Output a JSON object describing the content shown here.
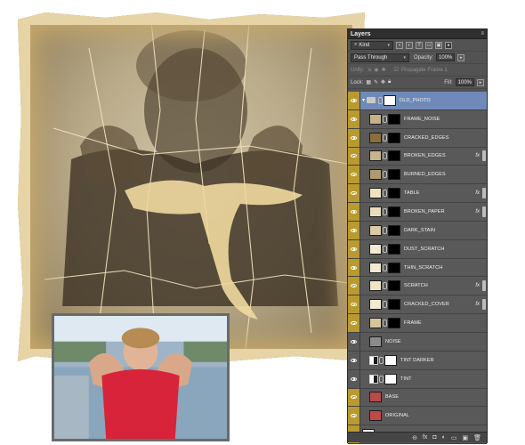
{
  "panel": {
    "title": "Layers",
    "menu_icon": "≡",
    "kind_label": "Kind",
    "blend_mode": "Pass Through",
    "opacity_label": "Opacity:",
    "opacity_value": "100%",
    "unify_label": "Unify:",
    "propagate_label": "Propagate Frame 1",
    "lock_label": "Lock:",
    "fill_label": "Fill:",
    "fill_value": "100%",
    "filter_icons": [
      "image-icon",
      "adjustment-icon",
      "type-icon",
      "shape-icon",
      "smart-object-icon"
    ]
  },
  "layers": [
    {
      "name": "OLD_PHOTO",
      "type": "group",
      "selected": true,
      "eye": true,
      "indent": 0
    },
    {
      "name": "FRAME_NOISE",
      "thumb": "#c6b28a",
      "mask": "black",
      "fx": false,
      "eye": true,
      "indent": 1
    },
    {
      "name": "CRACKED_EDGES",
      "thumb": "#8a6e3c",
      "mask": "black",
      "fx": false,
      "eye": true,
      "indent": 1
    },
    {
      "name": "BROKEN_EDGES",
      "thumb": "#c8b48c",
      "mask": "black",
      "fx": true,
      "eye": true,
      "indent": 1
    },
    {
      "name": "BURNED_EDGES",
      "thumb": "#b09a70",
      "mask": "black",
      "fx": false,
      "eye": true,
      "indent": 1
    },
    {
      "name": "TABLE",
      "thumb": "#efe2c0",
      "mask": "black",
      "fx": true,
      "eye": true,
      "indent": 1
    },
    {
      "name": "BROKEN_PAPER",
      "thumb": "#e9dcbd",
      "mask": "black",
      "fx": true,
      "eye": true,
      "indent": 1
    },
    {
      "name": "DARK_STAIN",
      "thumb": "#d9cba8",
      "mask": "black",
      "fx": false,
      "eye": true,
      "indent": 1
    },
    {
      "name": "DUST_SCRATCH",
      "thumb": "#f3ead3",
      "mask": "black",
      "fx": false,
      "eye": true,
      "indent": 1
    },
    {
      "name": "THIN_SCRATCH",
      "thumb": "#f3ead3",
      "mask": "black",
      "fx": false,
      "eye": true,
      "indent": 1
    },
    {
      "name": "SCRATCH",
      "thumb": "#f0e4c6",
      "mask": "black",
      "fx": true,
      "eye": true,
      "indent": 1
    },
    {
      "name": "CRACKED_COVER",
      "thumb": "#f3ead3",
      "mask": "black",
      "fx": true,
      "eye": true,
      "indent": 1
    },
    {
      "name": "FRAME",
      "thumb": "#d6c49b",
      "mask": "black",
      "fx": false,
      "eye": true,
      "indent": 1
    },
    {
      "name": "NOISE",
      "thumb": "#8c8c8c",
      "mask": "none",
      "fx": false,
      "eye": false,
      "indent": 1
    },
    {
      "name": "TINT DARKER",
      "type": "adjustment",
      "mask": "white",
      "fx": false,
      "eye": false,
      "indent": 1
    },
    {
      "name": "TINT",
      "type": "adjustment",
      "mask": "white",
      "fx": false,
      "eye": false,
      "indent": 1
    },
    {
      "name": "BASE",
      "thumb": "#b84a4a",
      "mask": "none",
      "fx": false,
      "eye": true,
      "indent": 1
    },
    {
      "name": "ORIGINAL",
      "thumb": "#c24848",
      "mask": "none",
      "fx": false,
      "eye": true,
      "indent": 1
    },
    {
      "name": "Background",
      "thumb": "#ffffff",
      "mask": "none",
      "fx": false,
      "eye": true,
      "indent": 0,
      "locked": true
    }
  ],
  "bottom_icons": [
    "link-icon",
    "fx-icon",
    "mask-icon",
    "adjustment-icon",
    "folder-icon",
    "new-layer-icon",
    "trash-icon"
  ],
  "bottom_glyphs": [
    "⊖",
    "fx",
    "◘",
    "◐",
    "▭",
    "▣",
    "🗑"
  ],
  "colors": {
    "panel_bg": "#535353",
    "eye_column_highlight": "#b89a2f",
    "selected_row": "#6f8ab8"
  }
}
